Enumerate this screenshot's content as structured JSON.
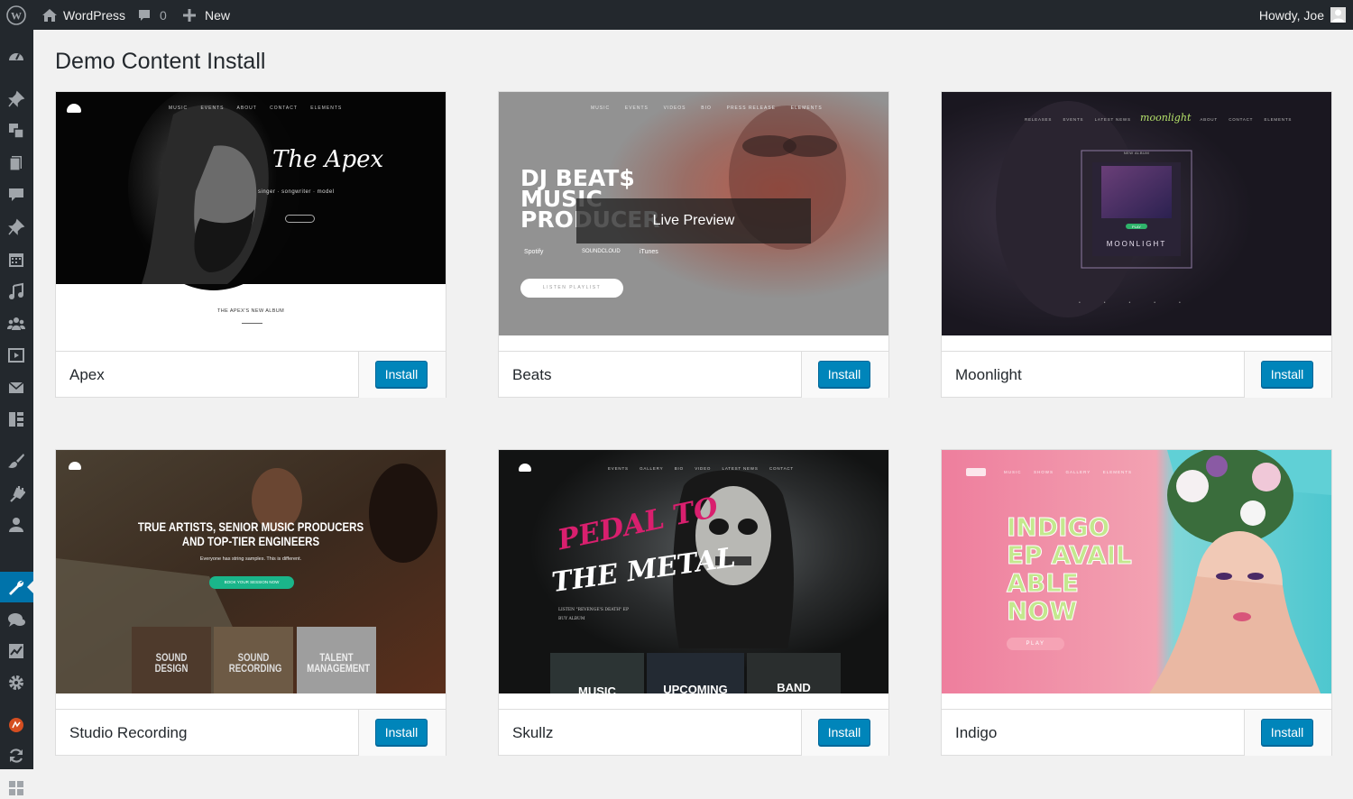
{
  "admin_bar": {
    "wp_logo_icon": "wordpress-logo-icon",
    "site_name": "WordPress",
    "comments_count": "0",
    "new_label": "New",
    "greeting": "Howdy, Joe"
  },
  "sidebar": {
    "icons": [
      "dashboard-icon",
      "pin-icon",
      "media-icon",
      "pages-icon",
      "comments-icon",
      "pin-icon",
      "calendar-icon",
      "music-icon",
      "people-icon",
      "video-icon",
      "mail-icon",
      "grid-icon",
      "brush-icon",
      "plugin-icon",
      "user-icon",
      "wrench-icon",
      "chat-icon",
      "stats-icon",
      "settings-icon",
      "logo-icon",
      "refresh-icon",
      "grid-icon"
    ],
    "active": "wrench-icon"
  },
  "page": {
    "title": "Demo Content Install",
    "live_preview_label": "Live Preview"
  },
  "demos": [
    {
      "name": "Apex",
      "button": "Install",
      "thumb_text": [
        "MUSIC",
        "EVENTS",
        "ABOUT",
        "CONTACT",
        "ELEMENTS",
        "The Apex",
        "singer · songwriter · model",
        "THE APEX'S NEW ALBUM"
      ]
    },
    {
      "name": "Beats",
      "button": "Install",
      "thumb_text": [
        "MUSIC",
        "EVENTS",
        "VIDEOS",
        "BIO",
        "PRESS RELEASE",
        "ELEMENTS",
        "DJ BEAT$",
        "MUSIC",
        "PRODUCER",
        "Spotify",
        "SOUNDCLOUD",
        "iTunes",
        "LISTEN PLAYLIST"
      ]
    },
    {
      "name": "Moonlight",
      "button": "Install",
      "thumb_text": [
        "RELEASES",
        "EVENTS",
        "LATEST NEWS",
        "moonlight",
        "ABOUT",
        "CONTACT",
        "ELEMENTS",
        "NEW ALBUM",
        "PLAY",
        "MOONLIGHT"
      ]
    },
    {
      "name": "Studio Recording",
      "button": "Install",
      "thumb_text": [
        "TRUE ARTISTS, SENIOR MUSIC PRODUCERS",
        "AND TOP-TIER ENGINEERS",
        "Everyone has string samples. This is different.",
        "BOOK YOUR SESSION NOW",
        "SOUND DESIGN",
        "SOUND RECORDING",
        "TALENT MANAGEMENT"
      ]
    },
    {
      "name": "Skullz",
      "button": "Install",
      "thumb_text": [
        "EVENTS",
        "GALLERY",
        "BIO",
        "VIDEO",
        "LATEST NEWS",
        "CONTACT",
        "PEDAL TO",
        "THE METAL",
        "LISTEN \"REVENGE'S DEATH\" EP",
        "BUY ALBUM",
        "MUSIC",
        "UPCOMING",
        "BAND"
      ]
    },
    {
      "name": "Indigo",
      "button": "Install",
      "thumb_text": [
        "MUSIC",
        "SHOWS",
        "GALLERY",
        "ELEMENTS",
        "INDIGO",
        "EP AVAIL",
        "ABLE",
        "NOW",
        "PLAY"
      ]
    }
  ],
  "colors": {
    "admin_bar": "#23282d",
    "accent": "#0085ba",
    "active_menu": "#0073aa",
    "background": "#f1f1f1"
  }
}
